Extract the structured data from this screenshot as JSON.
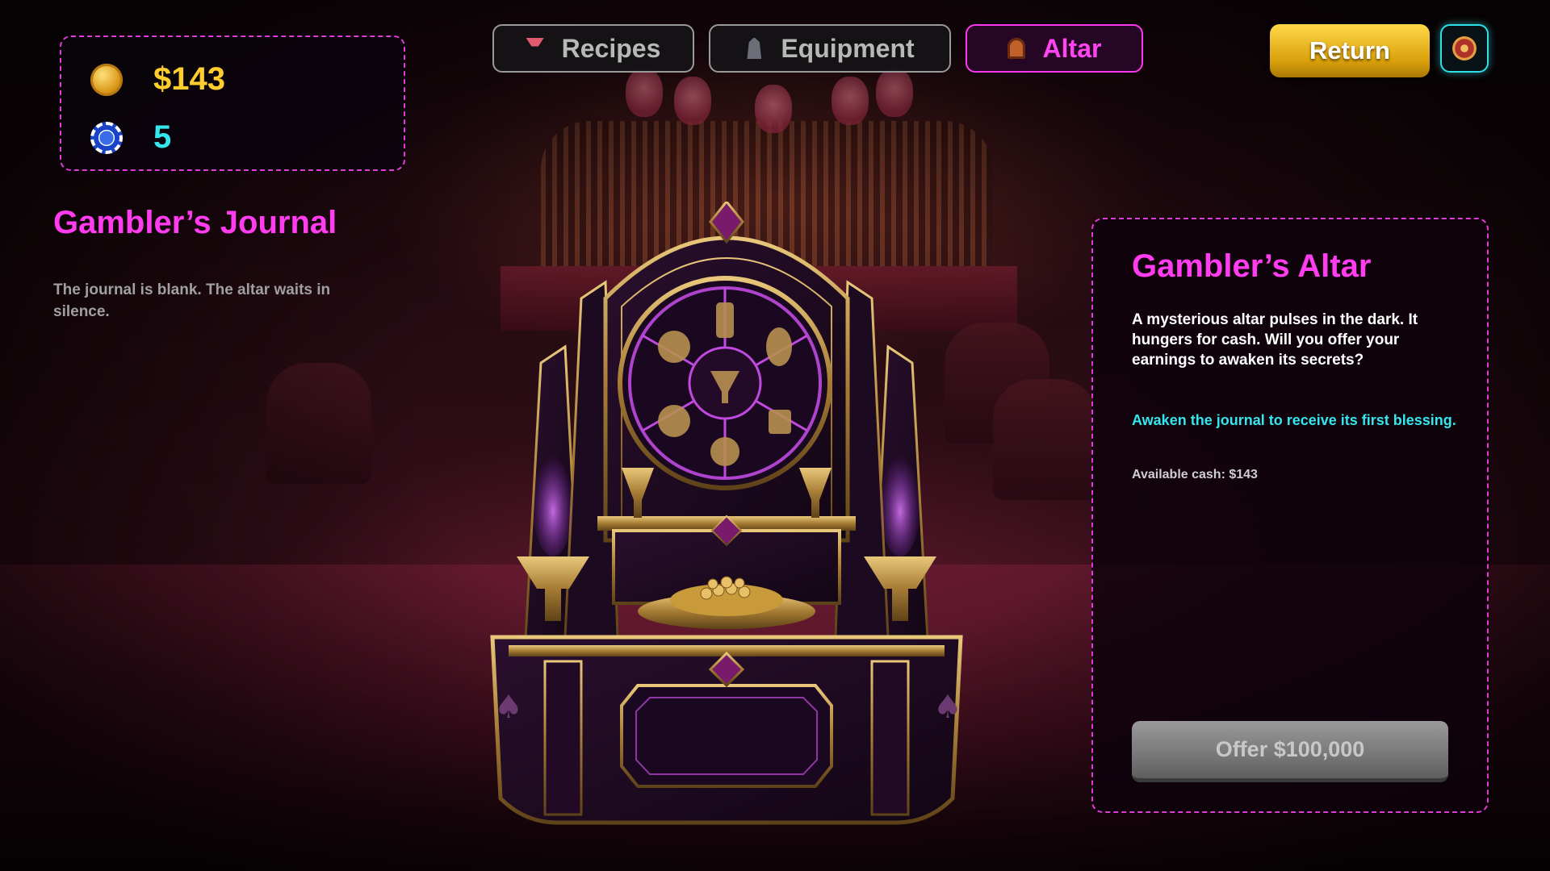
{
  "hud": {
    "cash": "$143",
    "chips": "5",
    "cash_icon": "gold-coin-icon",
    "chips_icon": "poker-chip-icon"
  },
  "tabs": [
    {
      "label": "Recipes",
      "icon": "cocktail-icon",
      "active": false
    },
    {
      "label": "Equipment",
      "icon": "shaker-icon",
      "active": false
    },
    {
      "label": "Altar",
      "icon": "altar-icon",
      "active": true
    }
  ],
  "return_label": "Return",
  "settings_icon": "roulette-wheel-icon",
  "journal": {
    "title": "Gambler’s Journal",
    "text": "The journal is blank. The altar waits in silence."
  },
  "panel": {
    "title": "Gambler’s Altar",
    "description": "A mysterious altar pulses in the dark. It hungers for cash. Will you offer your earnings to awaken its secrets?",
    "hint": "Awaken the journal to receive its first blessing.",
    "available_cash": "Available cash: $143",
    "offer_label": "Offer $100,000",
    "offer_enabled": false
  },
  "altar_wheel_icons": [
    "lemon-icon",
    "bottle-icon",
    "pineapple-icon",
    "coconut-icon",
    "cocktail-glass-icon",
    "whiskey-glass-icon",
    "lucky-cat-icon"
  ],
  "colors": {
    "accent_magenta": "#ff3cf0",
    "accent_cyan": "#34e6ee",
    "cash_gold": "#ffce2e",
    "return_gold": "#e8b71c"
  }
}
